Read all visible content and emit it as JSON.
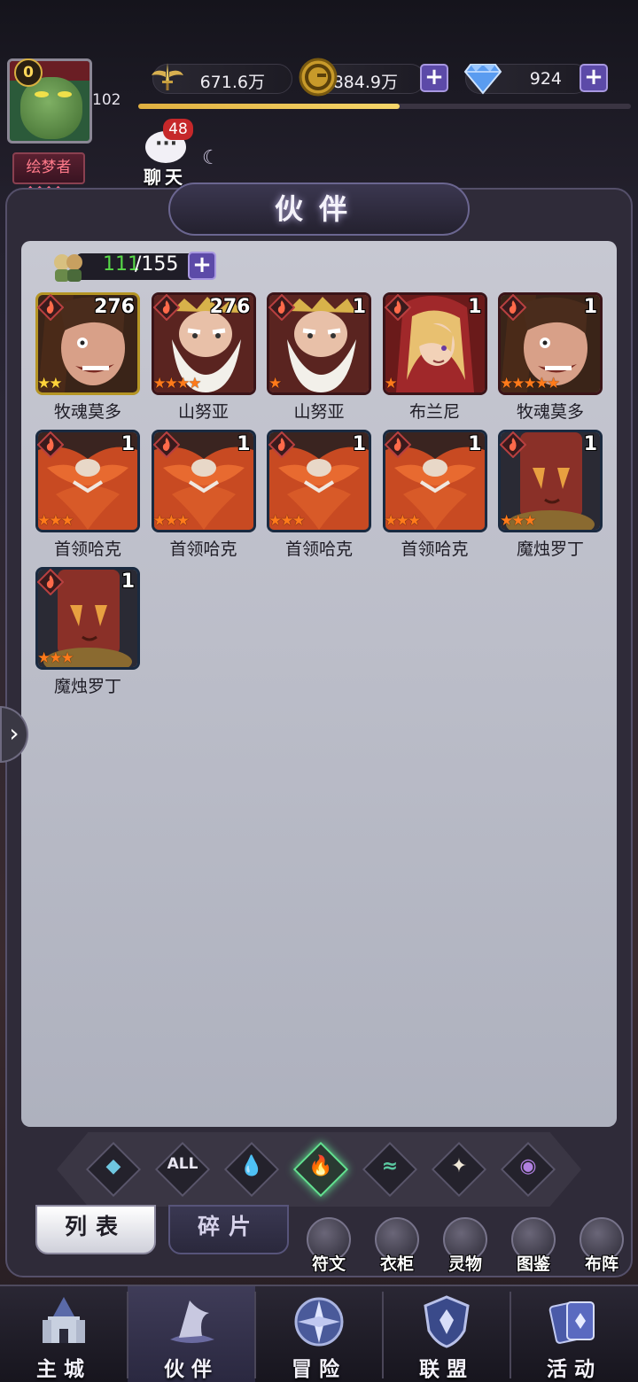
{
  "player": {
    "level": "102",
    "vip": "0",
    "title": "绘梦者",
    "title_decor": "◆◆◆◆"
  },
  "resources": {
    "power": "671.6万",
    "gold": "884.9万",
    "gems": "924",
    "plus": "+"
  },
  "xp_fraction": 0.53,
  "chat": {
    "label": "聊天",
    "unread": "48"
  },
  "panel": {
    "title": "伙伴"
  },
  "partner_count": {
    "current": "111",
    "max": "/155"
  },
  "partners": [
    {
      "name": "牧魂莫多",
      "count": "276",
      "stars": "★★",
      "star_color": "yellow",
      "frame": "gold",
      "art": "mordo"
    },
    {
      "name": "山努亚",
      "count": "276",
      "stars": "★★★★",
      "star_color": "orange",
      "frame": "red",
      "art": "king"
    },
    {
      "name": "山努亚",
      "count": "1",
      "stars": "★",
      "star_color": "orange",
      "frame": "red",
      "art": "king"
    },
    {
      "name": "布兰尼",
      "count": "1",
      "stars": "★",
      "star_color": "orange",
      "frame": "red",
      "art": "blonde"
    },
    {
      "name": "牧魂莫多",
      "count": "1",
      "stars": "★★★★★",
      "star_color": "orange",
      "frame": "red",
      "art": "mordo"
    },
    {
      "name": "首领哈克",
      "count": "1",
      "stars": "★★★",
      "star_color": "orange",
      "frame": "blue",
      "art": "hak"
    },
    {
      "name": "首领哈克",
      "count": "1",
      "stars": "★★★",
      "star_color": "orange",
      "frame": "blue",
      "art": "hak"
    },
    {
      "name": "首领哈克",
      "count": "1",
      "stars": "★★★",
      "star_color": "orange",
      "frame": "blue",
      "art": "hak"
    },
    {
      "name": "首领哈克",
      "count": "1",
      "stars": "★★★",
      "star_color": "orange",
      "frame": "blue",
      "art": "hak"
    },
    {
      "name": "魔烛罗丁",
      "count": "1",
      "stars": "★★★",
      "star_color": "orange",
      "frame": "blue",
      "art": "candle"
    },
    {
      "name": "魔烛罗丁",
      "count": "1",
      "stars": "★★★",
      "star_color": "orange",
      "frame": "blue",
      "art": "candle"
    }
  ],
  "filters": [
    {
      "name": "light",
      "glyph": "◆",
      "color": "#6fc7e0"
    },
    {
      "name": "all",
      "glyph": "ALL",
      "color": "#e8e6f2"
    },
    {
      "name": "water",
      "glyph": "💧",
      "color": "#5aa0e8"
    },
    {
      "name": "fire",
      "glyph": "🔥",
      "color": "#e05a40",
      "active": true
    },
    {
      "name": "wind",
      "glyph": "≈",
      "color": "#5ac8a0"
    },
    {
      "name": "star",
      "glyph": "✦",
      "color": "#f0e8d8"
    },
    {
      "name": "dark",
      "glyph": "◉",
      "color": "#b080e0"
    }
  ],
  "subtabs": {
    "list": "列表",
    "fragments": "碎片"
  },
  "tools": [
    "符文",
    "衣柜",
    "灵物",
    "图鉴",
    "布阵"
  ],
  "nav": [
    "主城",
    "伙伴",
    "冒险",
    "联盟",
    "活动"
  ],
  "colors": {
    "accent_purple": "#5c4aa8",
    "count_green": "#58d848",
    "star_orange": "#ff7a1a",
    "star_yellow": "#ffd23a"
  }
}
